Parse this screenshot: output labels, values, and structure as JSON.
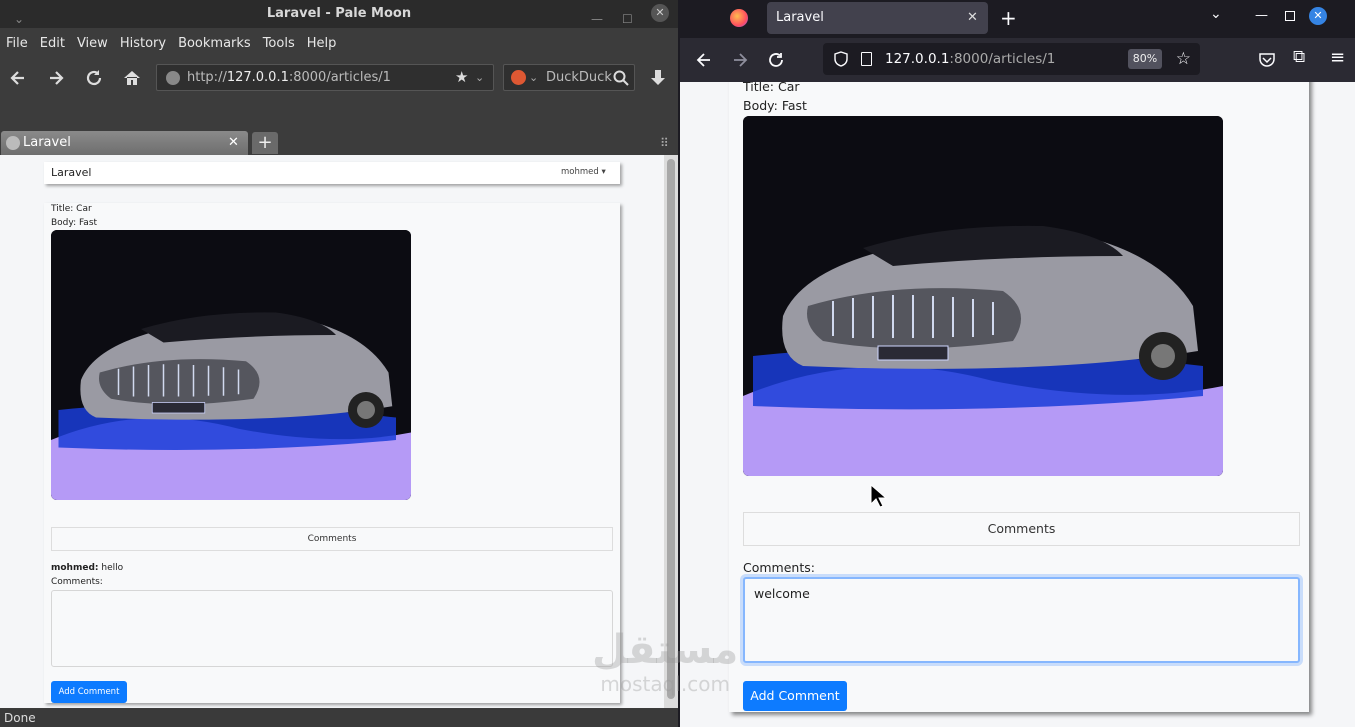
{
  "pale_moon": {
    "window_title": "Laravel - Pale Moon",
    "menu": [
      "File",
      "Edit",
      "View",
      "History",
      "Bookmarks",
      "Tools",
      "Help"
    ],
    "url_prefix": "http://",
    "url_host": "127.0.0.1",
    "url_rest": ":8000/articles/1",
    "search_placeholder": "DuckDuckGo",
    "tab_title": "Laravel",
    "status": "Done",
    "page": {
      "brand": "Laravel",
      "user": "mohmed",
      "title_line": "Title: Car",
      "body_line": "Body: Fast",
      "comments_header": "Comments",
      "comment_author": "mohmed:",
      "comment_text": "hello",
      "comments_label": "Comments:",
      "textarea_value": "",
      "submit_label": "Add Comment"
    }
  },
  "firefox": {
    "tab_title": "Laravel",
    "url_host": "127.0.0.1",
    "url_rest": ":8000/articles/1",
    "zoom": "80%",
    "page": {
      "title_line": "Title: Car",
      "body_line": "Body: Fast",
      "comments_header": "Comments",
      "comments_label": "Comments:",
      "textarea_value": "welcome",
      "submit_label": "Add Comment"
    }
  },
  "watermark": {
    "arabic": "مستقل",
    "latin": "mostaql.com"
  },
  "colors": {
    "primary_button": "#0d7bff",
    "firefox_chrome": "#2b2a33",
    "palemoon_chrome": "#3c3c3c"
  }
}
